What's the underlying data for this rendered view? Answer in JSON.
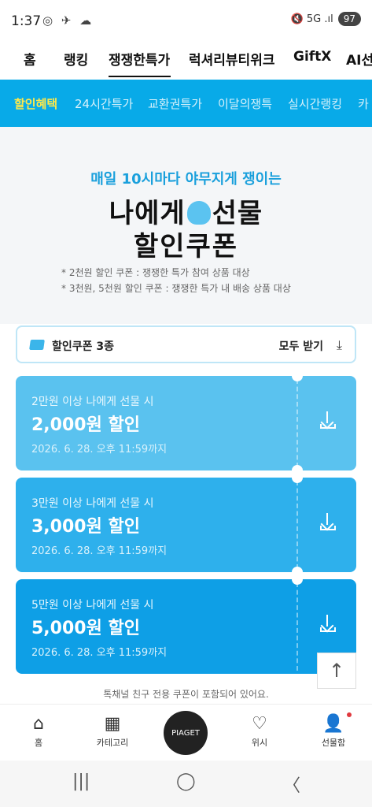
{
  "status": {
    "time": "1:37",
    "icons": "◎ ✈ ☁",
    "right": "🔇 5G .ıl",
    "battery": "97"
  },
  "topnav": [
    "홈",
    "랭킹",
    "쟁쟁한특가",
    "럭셔리뷰티위크",
    "GiftX",
    "AI선"
  ],
  "subnav": [
    "할인혜택",
    "24시간특가",
    "교환권특가",
    "이달의쟁특",
    "실시간랭킹",
    "카"
  ],
  "hero": {
    "line1": "매일 10시마다 야무지게 쟁이는",
    "line2a": "나에게",
    "line2b": "선물",
    "line3": "할인쿠폰",
    "note1": "* 2천원 할인 쿠폰 : 쟁쟁한 특가 참여 상품 대상",
    "note2": "* 3천원, 5천원 할인 쿠폰 : 쟁쟁한 특가 내 배송 상품 대상"
  },
  "couponbar": {
    "title": "할인쿠폰 3종",
    "getall": "모두 받기"
  },
  "coupons": [
    {
      "cond": "2만원 이상 나에게 선물 시",
      "amount": "2,000원 할인",
      "exp": "2026. 6. 28. 오후 11:59까지",
      "color": "#5ac2ef"
    },
    {
      "cond": "3만원 이상 나에게 선물 시",
      "amount": "3,000원 할인",
      "exp": "2026. 6. 28. 오후 11:59까지",
      "color": "#2eb0ec"
    },
    {
      "cond": "5만원 이상 나에게 선물 시",
      "amount": "5,000원 할인",
      "exp": "2026. 6. 28. 오후 11:59까지",
      "color": "#0e9fe6"
    }
  ],
  "footnote": "톡채널 친구 전용 쿠폰이 포함되어 있어요.",
  "bottomnav": {
    "home": "홈",
    "category": "카테고리",
    "center": "PIAGET",
    "wish": "위시",
    "giftbox": "선물함"
  },
  "sysnav": {
    "recent": "|||",
    "home": "◯",
    "back": "〈"
  }
}
